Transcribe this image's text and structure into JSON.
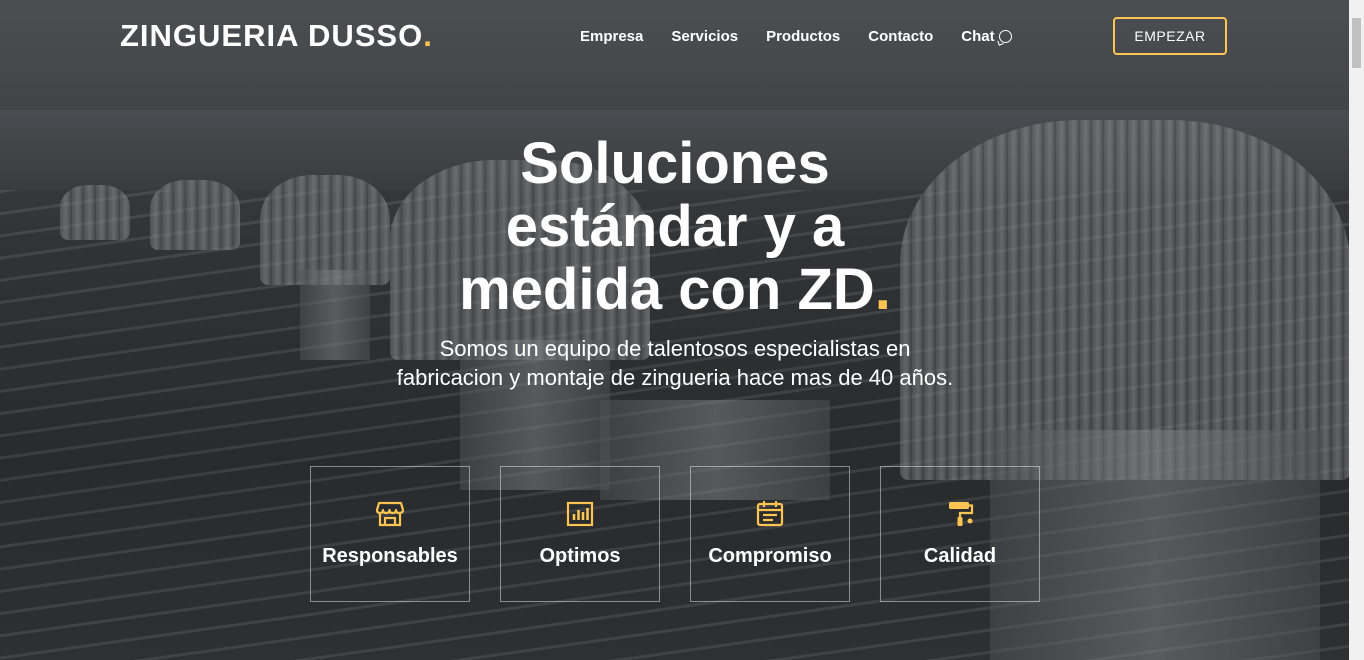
{
  "brand": {
    "name": "ZINGUERIA DUSSO",
    "dot": ".",
    "accent_color": "#ffc451"
  },
  "nav": {
    "items": [
      {
        "label": "Empresa"
      },
      {
        "label": "Servicios"
      },
      {
        "label": "Productos"
      },
      {
        "label": "Contacto"
      },
      {
        "label": "Chat",
        "icon": "whatsapp-icon"
      }
    ],
    "cta_label": "EMPEZAR"
  },
  "hero": {
    "title_line1": "Soluciones",
    "title_line2": "estándar y a",
    "title_line3": "medida con ZD",
    "title_dot": ".",
    "subtitle": "Somos un equipo de talentosos especialistas en fabricacion y montaje de zingueria hace mas de 40 años."
  },
  "features": [
    {
      "label": "Responsables",
      "icon": "store-icon"
    },
    {
      "label": "Optimos",
      "icon": "bar-chart-icon"
    },
    {
      "label": "Compromiso",
      "icon": "calendar-icon"
    },
    {
      "label": "Calidad",
      "icon": "paint-roller-icon"
    }
  ]
}
